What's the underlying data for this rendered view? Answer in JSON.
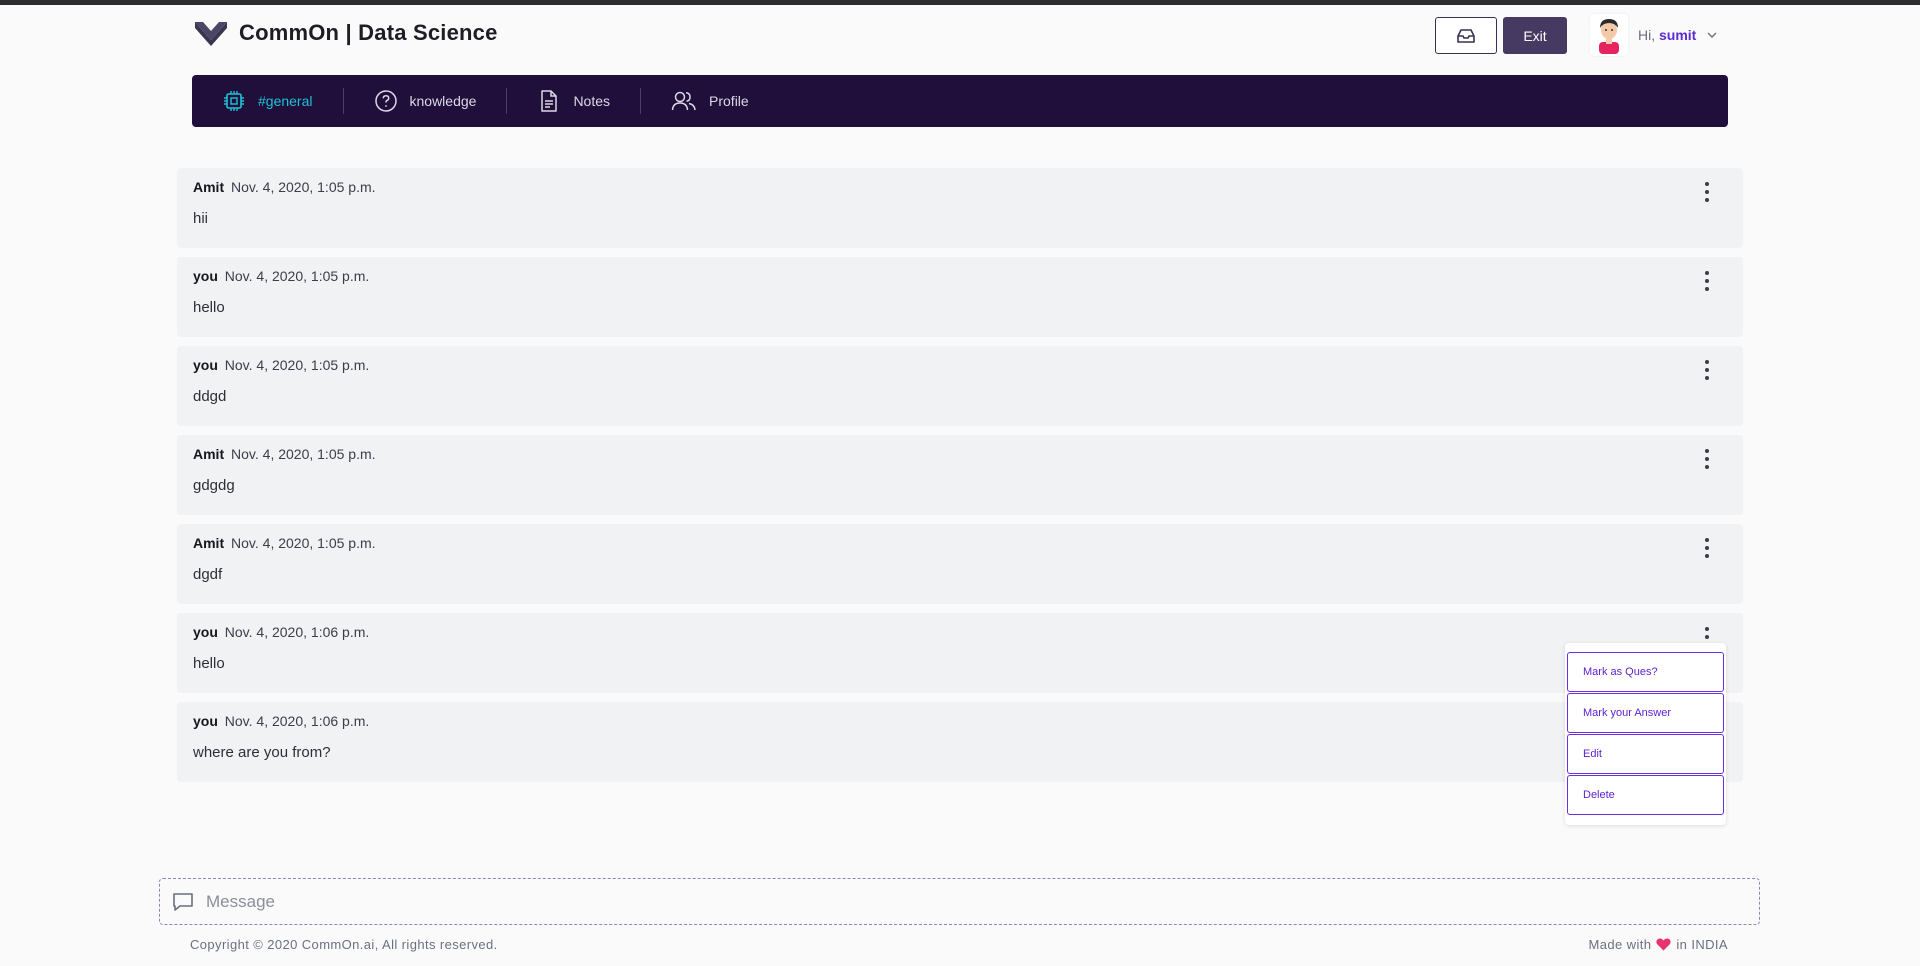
{
  "app": {
    "title": "CommOn | Data Science"
  },
  "header": {
    "exit_label": "Exit",
    "greeting": "Hi, ",
    "username": "sumit"
  },
  "nav": {
    "items": [
      {
        "label": "#general",
        "icon": "chip-icon",
        "active": true
      },
      {
        "label": "knowledge",
        "icon": "question-circle-icon",
        "active": false
      },
      {
        "label": "Notes",
        "icon": "document-icon",
        "active": false
      },
      {
        "label": "Profile",
        "icon": "users-icon",
        "active": false
      }
    ]
  },
  "messages": [
    {
      "author": "Amit",
      "time": "Nov. 4, 2020, 1:05 p.m.",
      "text": "hii"
    },
    {
      "author": "you",
      "time": "Nov. 4, 2020, 1:05 p.m.",
      "text": "hello"
    },
    {
      "author": "you",
      "time": "Nov. 4, 2020, 1:05 p.m.",
      "text": "ddgd"
    },
    {
      "author": "Amit",
      "time": "Nov. 4, 2020, 1:05 p.m.",
      "text": "gdgdg"
    },
    {
      "author": "Amit",
      "time": "Nov. 4, 2020, 1:05 p.m.",
      "text": "dgdf"
    },
    {
      "author": "you",
      "time": "Nov. 4, 2020, 1:06 p.m.",
      "text": "hello"
    },
    {
      "author": "you",
      "time": "Nov. 4, 2020, 1:06 p.m.",
      "text": "where are you from?"
    }
  ],
  "context_menu": {
    "items": [
      "Mark as Ques?",
      "Mark your Answer",
      "Edit",
      "Delete"
    ]
  },
  "composer": {
    "placeholder": "Message"
  },
  "footer": {
    "copyright": "Copyright © 2020 CommOn.ai, All rights reserved.",
    "made_with": "Made with",
    "in_country": "in INDIA"
  },
  "colors": {
    "nav_bg": "#1f0f3a",
    "accent": "#5d2bd3",
    "active_nav": "#1fc2d6",
    "exit_bg": "#463a63",
    "heart": "#e8336e"
  }
}
